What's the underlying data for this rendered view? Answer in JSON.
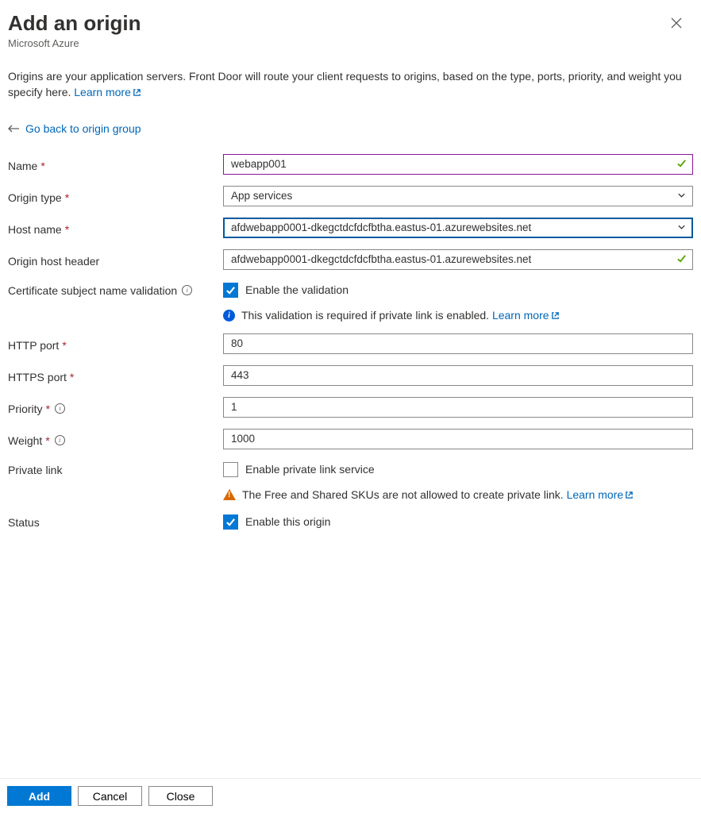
{
  "header": {
    "title": "Add an origin",
    "subtitle": "Microsoft Azure"
  },
  "description": {
    "text": "Origins are your application servers. Front Door will route your client requests to origins, based on the type, ports, priority, and weight you specify here. ",
    "learn_more": "Learn more"
  },
  "back_link": "Go back to origin group",
  "labels": {
    "name": "Name",
    "origin_type": "Origin type",
    "host_name": "Host name",
    "origin_host_header": "Origin host header",
    "cert_validation": "Certificate subject name validation",
    "http_port": "HTTP port",
    "https_port": "HTTPS port",
    "priority": "Priority",
    "weight": "Weight",
    "private_link": "Private link",
    "status": "Status"
  },
  "values": {
    "name": "webapp001",
    "origin_type": "App services",
    "host_name": "afdwebapp0001-dkegctdcfdcfbtha.eastus-01.azurewebsites.net",
    "origin_host_header": "afdwebapp0001-dkegctdcfdcfbtha.eastus-01.azurewebsites.net",
    "http_port": "80",
    "https_port": "443",
    "priority": "1",
    "weight": "1000"
  },
  "checkboxes": {
    "enable_validation": "Enable the validation",
    "enable_private_link": "Enable private link service",
    "enable_origin": "Enable this origin"
  },
  "notes": {
    "validation_info": "This validation is required if private link is enabled. ",
    "private_link_warn": "The Free and Shared SKUs are not allowed to create private link. ",
    "learn_more": "Learn more"
  },
  "buttons": {
    "add": "Add",
    "cancel": "Cancel",
    "close": "Close"
  }
}
